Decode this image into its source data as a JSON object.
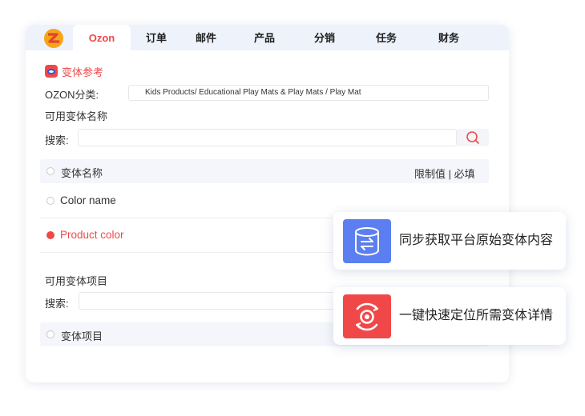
{
  "nav": {
    "tabs": [
      {
        "label": "Ozon",
        "active": true
      },
      {
        "label": "订单"
      },
      {
        "label": "邮件"
      },
      {
        "label": "产品"
      },
      {
        "label": "分销"
      },
      {
        "label": "任务"
      },
      {
        "label": "财务"
      }
    ]
  },
  "variant_ref": {
    "title": "变体参考",
    "category_label": "OZON分类:",
    "category_value": "Kids Products/ Educational Play Mats & Play Mats / Play Mat",
    "available_names_label": "可用变体名称",
    "search_label": "搜索:",
    "table_header": {
      "name": "变体名称",
      "constraint": "限制值 | 必填"
    },
    "rows": [
      {
        "name": "Color name",
        "selected": false
      },
      {
        "name": "Product color",
        "selected": true
      }
    ]
  },
  "variant_items": {
    "title": "可用变体项目",
    "search_label": "搜索:",
    "table_header": {
      "name": "变体项目"
    }
  },
  "features": [
    {
      "text": "同步获取平台原始变体内容",
      "icon": "database-sync-icon",
      "color": "#5b7ff0"
    },
    {
      "text": "一键快速定位所需变体详情",
      "icon": "target-locate-icon",
      "color": "#f04848"
    }
  ],
  "colors": {
    "accent": "#f04848",
    "nav_bg": "#eef2fb",
    "blue": "#5b7ff0"
  }
}
